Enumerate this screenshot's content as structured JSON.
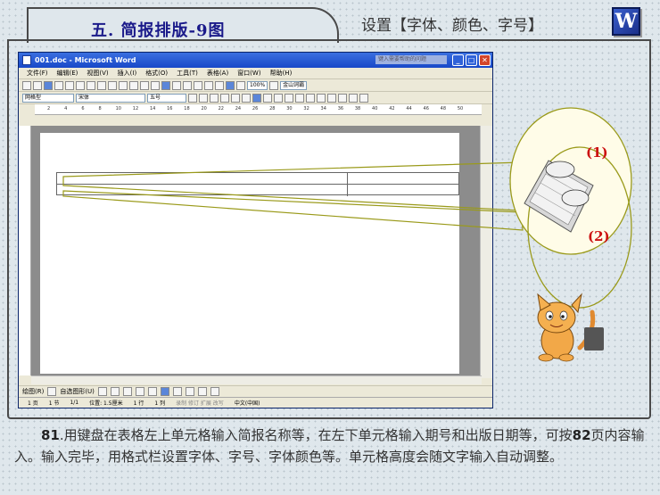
{
  "slide": {
    "title": "五. 简报排版-9图",
    "subtitle": "设置【字体、颜色、字号】",
    "logo_letter": "W"
  },
  "word_window": {
    "title": "001.doc - Microsoft Word",
    "ask_placeholder": "键入需要帮助的问题",
    "menus": [
      "文件(F)",
      "编辑(E)",
      "视图(V)",
      "插入(I)",
      "格式(O)",
      "工具(T)",
      "表格(A)",
      "窗口(W)",
      "帮助(H)"
    ],
    "zoom": "100%",
    "jinshan": "金山词霸",
    "style_value": "网格型",
    "font_value": "宋体",
    "size_value": "五号",
    "ruler_ticks": [
      "2",
      "4",
      "6",
      "8",
      "10",
      "12",
      "14",
      "16",
      "18",
      "20",
      "22",
      "24",
      "26",
      "28",
      "30",
      "32",
      "34",
      "36",
      "38",
      "40",
      "42",
      "44",
      "46",
      "48",
      "50"
    ],
    "draw_label": "绘图(R)",
    "autoshape_label": "自选图形(U)",
    "status": {
      "page": "1 页",
      "section": "1 节",
      "position": "1/1",
      "at": "位置: 1.5厘米",
      "line": "1 行",
      "col": "1 列",
      "modes": "录制 修订 扩展 改写",
      "lang": "中文(中国)"
    }
  },
  "callouts": {
    "label_1": "(1)",
    "label_2": "(2)"
  },
  "caption": {
    "num": "81",
    "text_a": ".用键盘在表格左上单元格输入简报名称等，在左下单元格输入期号和出版日期等，可按",
    "page_ref": "82",
    "text_b": "页内容输入。输入完毕，用格式栏设置字体、字号、字体颜色等。单元格高度会随文字输入自动调整。"
  },
  "colors": {
    "title_blue": "#1a1a8a",
    "label_red": "#cc1111",
    "callout_line": "#9a9a1a"
  }
}
